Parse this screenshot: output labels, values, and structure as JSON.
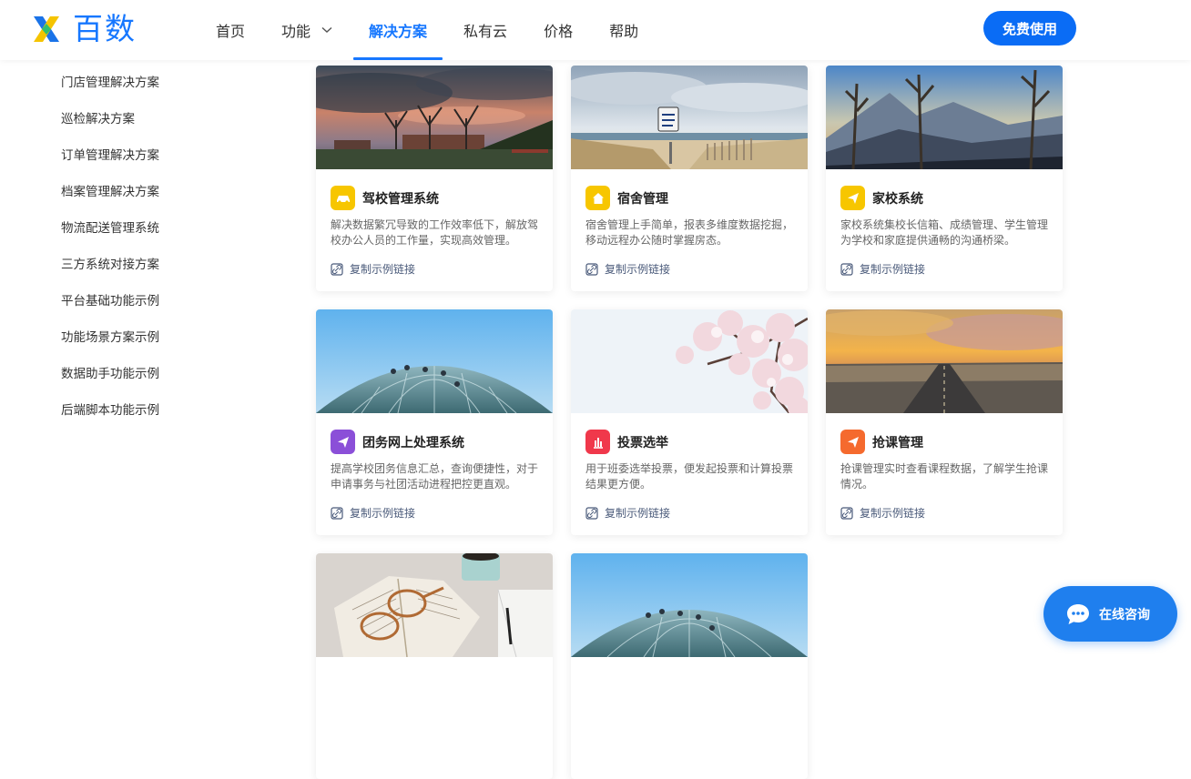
{
  "header": {
    "logo_text": "百数",
    "nav": [
      {
        "label": "首页"
      },
      {
        "label": "功能"
      },
      {
        "label": "解决方案"
      },
      {
        "label": "私有云"
      },
      {
        "label": "价格"
      },
      {
        "label": "帮助"
      }
    ],
    "active_nav": "解决方案",
    "free_button": "免费使用"
  },
  "sidebar": {
    "items": [
      {
        "label": "门店管理解决方案"
      },
      {
        "label": "巡检解决方案"
      },
      {
        "label": "订单管理解决方案"
      },
      {
        "label": "档案管理解决方案"
      },
      {
        "label": "物流配送管理系统"
      },
      {
        "label": "三方系统对接方案"
      },
      {
        "label": "平台基础功能示例"
      },
      {
        "label": "功能场景方案示例"
      },
      {
        "label": "数据助手功能示例"
      },
      {
        "label": "后端脚本功能示例"
      }
    ]
  },
  "cards": [
    {
      "title": "驾校管理系统",
      "desc": "解决数据繁冗导致的工作效率低下，解放驾校办公人员的工作量，实现高效管理。",
      "copy": "复制示例链接",
      "icon": "car-icon",
      "icon_color": "#f7c600"
    },
    {
      "title": "宿舍管理",
      "desc": "宿舍管理上手简单，报表多维度数据挖掘，移动远程办公随时掌握房态。",
      "copy": "复制示例链接",
      "icon": "home-icon",
      "icon_color": "#f7c600"
    },
    {
      "title": "家校系统",
      "desc": "家校系统集校长信箱、成绩管理、学生管理为学校和家庭提供通畅的沟通桥梁。",
      "copy": "复制示例链接",
      "icon": "send-icon",
      "icon_color": "#f7c600"
    },
    {
      "title": "团务网上处理系统",
      "desc": "提高学校团务信息汇总，查询便捷性，对于申请事务与社团活动进程把控更直观。",
      "copy": "复制示例链接",
      "icon": "send-icon",
      "icon_color": "#8b4fd8"
    },
    {
      "title": "投票选举",
      "desc": "用于班委选举投票，便发起投票和计算投票结果更方便。",
      "copy": "复制示例链接",
      "icon": "bar-chart-icon",
      "icon_color": "#f0384b"
    },
    {
      "title": "抢课管理",
      "desc": "抢课管理实时查看课程数据，了解学生抢课情况。",
      "copy": "复制示例链接",
      "icon": "send-icon",
      "icon_color": "#f56a2e"
    },
    {
      "title": "",
      "desc": "",
      "copy": "",
      "icon": "",
      "icon_color": ""
    },
    {
      "title": "",
      "desc": "",
      "copy": "",
      "icon": "",
      "icon_color": ""
    }
  ],
  "consult": {
    "label": "在线咨询"
  },
  "colors": {
    "brand": "#1677ff",
    "button": "#0a6cf5",
    "consult": "#1f7fee"
  }
}
